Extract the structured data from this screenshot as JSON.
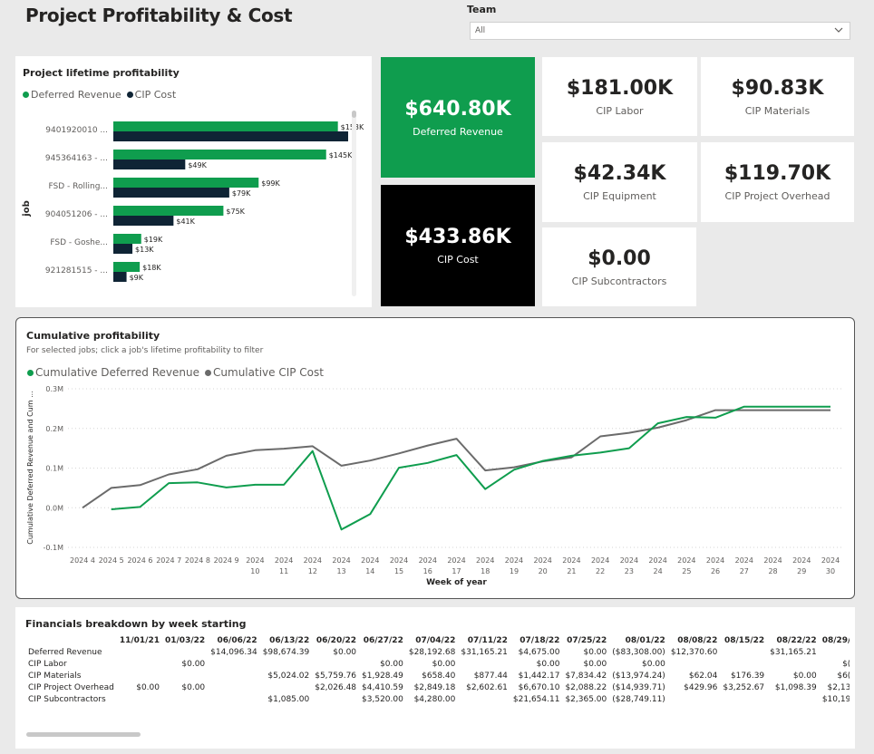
{
  "page": {
    "title": "Project Profitability & Cost"
  },
  "filter": {
    "label": "Team",
    "value": "All"
  },
  "bar_panel": {
    "title": "Project lifetime profitability",
    "legend": [
      "Deferred Revenue",
      "CIP Cost"
    ],
    "y_axis_title": "job",
    "colors": {
      "deferred": "#0f9d4e",
      "cip": "#0f2435"
    }
  },
  "kpis": {
    "deferred_revenue": {
      "value": "$640.80K",
      "label": "Deferred Revenue"
    },
    "cip_cost": {
      "value": "$433.86K",
      "label": "CIP Cost"
    },
    "cip_labor": {
      "value": "$181.00K",
      "label": "CIP Labor"
    },
    "cip_materials": {
      "value": "$90.83K",
      "label": "CIP Materials"
    },
    "cip_equipment": {
      "value": "$42.34K",
      "label": "CIP Equipment"
    },
    "cip_overhead": {
      "value": "$119.70K",
      "label": "CIP Project Overhead"
    },
    "cip_subcontractors": {
      "value": "$0.00",
      "label": "CIP Subcontractors"
    }
  },
  "line_panel": {
    "title": "Cumulative profitability",
    "subtitle": "For selected jobs; click a job's lifetime profitability to filter",
    "legend": [
      "Cumulative Deferred Revenue",
      "Cumulative CIP Cost"
    ],
    "y_axis_title": "Cumulative Deferred Revenue and Cum ...",
    "x_axis_title": "Week of year",
    "colors": {
      "revenue": "#0f9d4e",
      "cost": "#6b6b6b"
    }
  },
  "table_panel": {
    "title": "Financials breakdown by week starting",
    "columns": [
      "11/01/21",
      "01/03/22",
      "06/06/22",
      "06/13/22",
      "06/20/22",
      "06/27/22",
      "07/04/22",
      "07/11/22",
      "07/18/22",
      "07/25/22",
      "08/01/22",
      "08/08/22",
      "08/15/22",
      "08/22/22",
      "08/29/"
    ],
    "rows": [
      {
        "label": "Deferred Revenue",
        "cells": [
          "",
          "",
          "$14,096.34",
          "$98,674.39",
          "$0.00",
          "",
          "$28,192.68",
          "$31,165.21",
          "$4,675.00",
          "$0.00",
          "($83,308.00)",
          "$12,370.60",
          "",
          "$31,165.21",
          ""
        ]
      },
      {
        "label": "CIP Labor",
        "cells": [
          "",
          "$0.00",
          "",
          "",
          "",
          "$0.00",
          "$0.00",
          "",
          "$0.00",
          "$0.00",
          "$0.00",
          "",
          "",
          "",
          "$("
        ]
      },
      {
        "label": "CIP Materials",
        "cells": [
          "",
          "",
          "",
          "$5,024.02",
          "$5,759.76",
          "$1,928.49",
          "$658.40",
          "$877.44",
          "$1,442.17",
          "$7,834.42",
          "($13,974.24)",
          "$62.04",
          "$176.39",
          "$0.00",
          "$6("
        ]
      },
      {
        "label": "CIP Project Overhead",
        "cells": [
          "$0.00",
          "$0.00",
          "",
          "",
          "$2,026.48",
          "$4,410.59",
          "$2,849.18",
          "$2,602.61",
          "$6,670.10",
          "$2,088.22",
          "($14,939.71)",
          "$429.96",
          "$3,252.67",
          "$1,098.39",
          "$2,13"
        ]
      },
      {
        "label": "CIP Subcontractors",
        "cells": [
          "",
          "",
          "",
          "$1,085.00",
          "",
          "$3,520.00",
          "$4,280.00",
          "",
          "$21,654.11",
          "$2,365.00",
          "($28,749.11)",
          "",
          "",
          "",
          "$10,19"
        ]
      }
    ]
  },
  "chart_data": [
    {
      "type": "bar",
      "title": "Project lifetime profitability",
      "orientation": "horizontal",
      "ylabel": "job",
      "categories": [
        "9401920010 ...",
        "945364163 - ...",
        "FSD - Rolling...",
        "904051206 - ...",
        "FSD - Goshe...",
        "921281515 - ..."
      ],
      "series": [
        {
          "name": "Deferred Revenue",
          "values": [
            153,
            145,
            99,
            75,
            19,
            18
          ],
          "labels": [
            "$153K",
            "$145K",
            "$99K",
            "$75K",
            "$19K",
            "$18K"
          ]
        },
        {
          "name": "CIP Cost",
          "values": [
            160,
            49,
            79,
            41,
            13,
            9
          ],
          "labels": [
            "",
            "$49K",
            "$79K",
            "$41K",
            "$13K",
            "$9K"
          ]
        }
      ],
      "xlim": [
        0,
        160
      ]
    },
    {
      "type": "line",
      "title": "Cumulative profitability",
      "xlabel": "Week of year",
      "ylabel": "Cumulative Deferred Revenue and Cum ...",
      "x": [
        "2024 4",
        "2024 5",
        "2024 6",
        "2024 7",
        "2024 8",
        "2024 9",
        "2024 10",
        "2024 11",
        "2024 12",
        "2024 13",
        "2024 14",
        "2024 15",
        "2024 16",
        "2024 17",
        "2024 18",
        "2024 19",
        "2024 20",
        "2024 21",
        "2024 22",
        "2024 23",
        "2024 24",
        "2024 25",
        "2024 26",
        "2024 27",
        "2024 28",
        "2024 29",
        "2024 30"
      ],
      "yticks": [
        "0.3M",
        "0.2M",
        "0.1M",
        "0.0M",
        "-0.1M"
      ],
      "ylim": [
        -0.1,
        0.3
      ],
      "series": [
        {
          "name": "Cumulative Deferred Revenue",
          "values": [
            null,
            -0.004,
            0.002,
            0.062,
            0.064,
            0.051,
            0.058,
            0.058,
            0.143,
            -0.055,
            -0.016,
            0.101,
            0.113,
            0.133,
            0.047,
            0.096,
            0.118,
            0.131,
            0.139,
            0.15,
            0.213,
            0.229,
            0.227,
            0.255,
            0.255,
            0.255,
            0.255
          ]
        },
        {
          "name": "Cumulative CIP Cost",
          "values": [
            0.0,
            0.05,
            0.057,
            0.084,
            0.097,
            0.131,
            0.145,
            0.149,
            0.155,
            0.106,
            0.119,
            0.137,
            0.157,
            0.174,
            0.094,
            0.102,
            0.117,
            0.127,
            0.18,
            0.189,
            0.202,
            0.221,
            0.246,
            0.246,
            0.246,
            0.246,
            0.246
          ]
        }
      ],
      "grid": true,
      "legend": "top-left"
    }
  ]
}
